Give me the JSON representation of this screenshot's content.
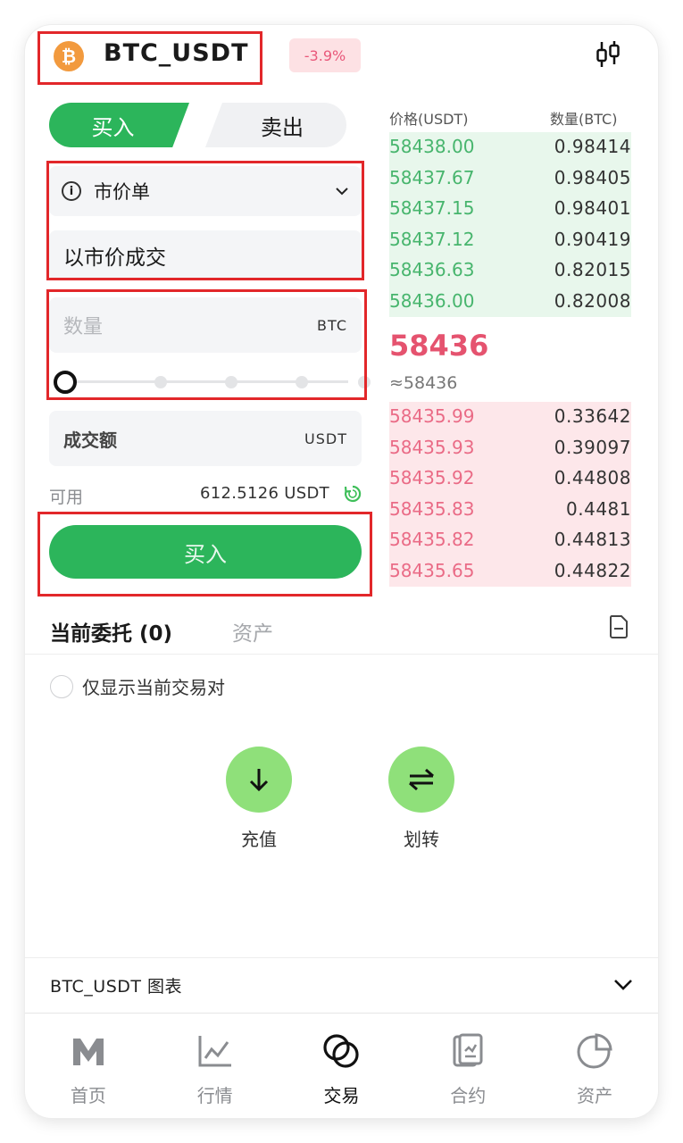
{
  "header": {
    "coin_symbol": "₿",
    "pair": "BTC_USDT",
    "change": "-3.9%"
  },
  "trade_tabs": {
    "buy": "买入",
    "sell": "卖出"
  },
  "form": {
    "order_type": "市价单",
    "market_price_text": "以市价成交",
    "quantity_placeholder": "数量",
    "quantity_unit": "BTC",
    "amount_label": "成交额",
    "amount_unit": "USDT",
    "available_label": "可用",
    "available_value": "612.5126 USDT",
    "submit_label": "买入",
    "slider_percent": 0
  },
  "order_book": {
    "price_header": "价格(USDT)",
    "qty_header": "数量(BTC)",
    "upper_rows": [
      {
        "price": "58438.00",
        "qty": "0.98414"
      },
      {
        "price": "58437.67",
        "qty": "0.98405"
      },
      {
        "price": "58437.15",
        "qty": "0.98401"
      },
      {
        "price": "58437.12",
        "qty": "0.90419"
      },
      {
        "price": "58436.63",
        "qty": "0.82015"
      },
      {
        "price": "58436.00",
        "qty": "0.82008"
      }
    ],
    "last_price": "58436",
    "last_price_approx": "≈58436",
    "lower_rows": [
      {
        "price": "58435.99",
        "qty": "0.33642"
      },
      {
        "price": "58435.93",
        "qty": "0.39097"
      },
      {
        "price": "58435.92",
        "qty": "0.44808"
      },
      {
        "price": "58435.83",
        "qty": "0.4481"
      },
      {
        "price": "58435.82",
        "qty": "0.44813"
      },
      {
        "price": "58435.65",
        "qty": "0.44822"
      }
    ]
  },
  "orders_section": {
    "tab_current": "当前委托 (0)",
    "tab_assets": "资产",
    "filter_label": "仅显示当前交易对",
    "deposit_label": "充值",
    "transfer_label": "划转"
  },
  "chart_bar": {
    "label": "BTC_USDT 图表"
  },
  "bottom_nav": [
    {
      "label": "首页",
      "icon": "m-logo-icon"
    },
    {
      "label": "行情",
      "icon": "line-chart-icon"
    },
    {
      "label": "交易",
      "icon": "overlap-circles-icon"
    },
    {
      "label": "合约",
      "icon": "contract-doc-icon"
    },
    {
      "label": "资产",
      "icon": "pie-chart-icon"
    }
  ],
  "colors": {
    "buy_green": "#2cb55b",
    "ask_green_text": "#47b56d",
    "bid_red_text": "#ea6b86",
    "last_price_red": "#e5536f",
    "highlight_red": "#e2272a",
    "action_green": "#8fe07a"
  }
}
